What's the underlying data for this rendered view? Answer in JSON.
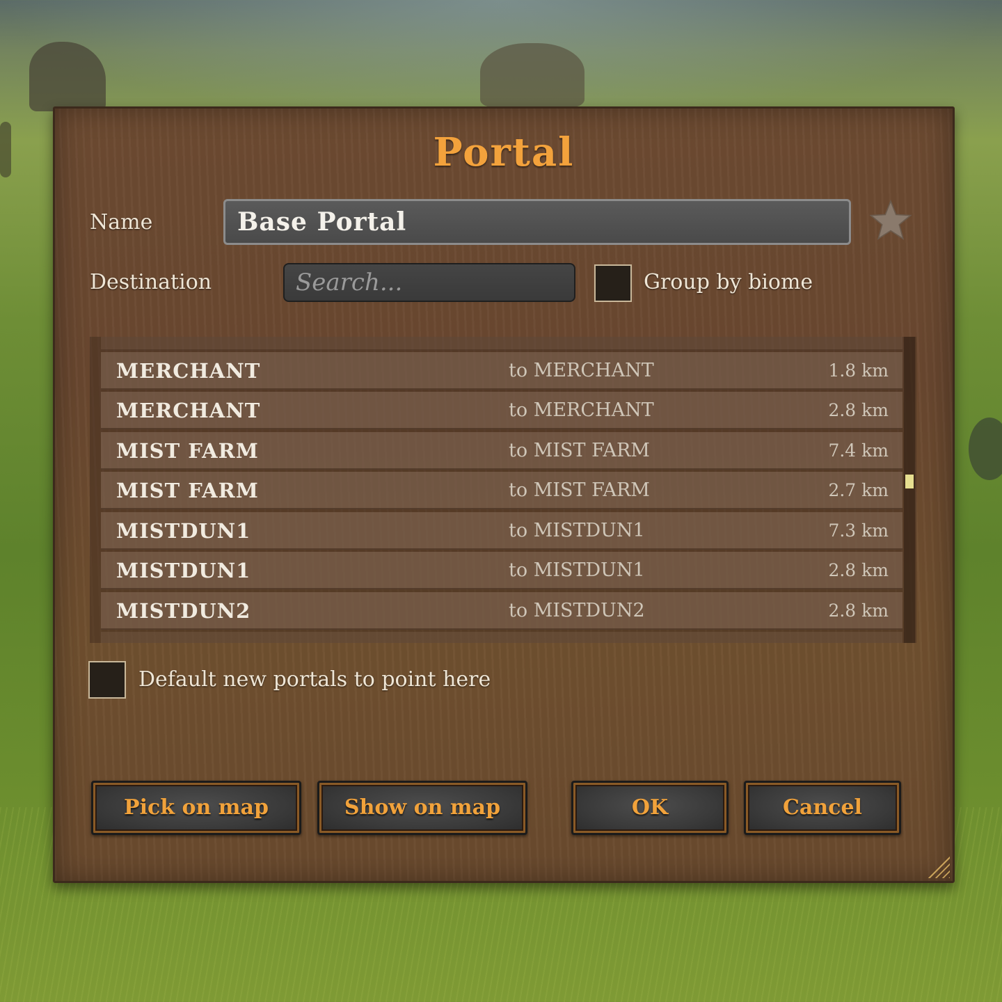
{
  "dialog": {
    "title": "Portal",
    "name_label": "Name",
    "name_value": "Base Portal",
    "destination_label": "Destination",
    "search_placeholder": "Search...",
    "group_by_biome_label": "Group by biome",
    "group_by_biome_checked": false,
    "default_label": "Default new portals to point here",
    "default_checked": false
  },
  "list": {
    "rows": [
      {
        "name": "MERCHANT",
        "destination": "to MERCHANT",
        "distance": "1.8 km"
      },
      {
        "name": "MERCHANT",
        "destination": "to MERCHANT",
        "distance": "2.8 km"
      },
      {
        "name": "MIST FARM",
        "destination": "to MIST FARM",
        "distance": "7.4 km"
      },
      {
        "name": "MIST FARM",
        "destination": "to MIST FARM",
        "distance": "2.7 km"
      },
      {
        "name": "MISTDUN1",
        "destination": "to MISTDUN1",
        "distance": "7.3 km"
      },
      {
        "name": "MISTDUN1",
        "destination": "to MISTDUN1",
        "distance": "2.8 km"
      },
      {
        "name": "MISTDUN2",
        "destination": "to MISTDUN2",
        "distance": "2.8 km"
      }
    ]
  },
  "buttons": {
    "pick_on_map": "Pick on map",
    "show_on_map": "Show on map",
    "ok": "OK",
    "cancel": "Cancel"
  },
  "colors": {
    "title": "#f3a23c",
    "button_text": "#f1a23b",
    "panel": "#6d4b32",
    "scroll_thumb": "#e7df90"
  },
  "icons": {
    "favorite": "star-icon"
  }
}
